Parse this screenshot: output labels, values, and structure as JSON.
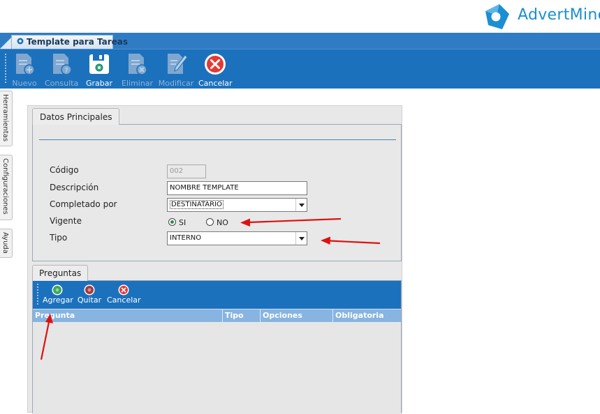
{
  "brand": {
    "name": "AdvertMind",
    "visible_text": "AdvertMinc",
    "color": "#1a8fd1"
  },
  "window_tab": {
    "title": "Template para Tareas"
  },
  "toolbar": {
    "buttons": [
      {
        "label": "Nuevo",
        "icon": "document-add-icon",
        "enabled": false
      },
      {
        "label": "Consulta",
        "icon": "document-query-icon",
        "enabled": false
      },
      {
        "label": "Grabar",
        "icon": "save-disk-icon",
        "enabled": true
      },
      {
        "label": "Eliminar",
        "icon": "document-delete-icon",
        "enabled": false
      },
      {
        "label": "Modificar",
        "icon": "document-edit-icon",
        "enabled": false
      },
      {
        "label": "Cancelar",
        "icon": "cancel-circle-icon",
        "enabled": true
      }
    ]
  },
  "side_tabs": [
    "Herramientas",
    "Configuraciones",
    "Ayuda"
  ],
  "datos_principales": {
    "tab_label": "Datos Principales",
    "fields": {
      "codigo": {
        "label": "Código",
        "value": "002"
      },
      "descripcion": {
        "label": "Descripción",
        "value": "NOMBRE TEMPLATE"
      },
      "completado_por": {
        "label": "Completado por",
        "value": "DESTINATARIO"
      },
      "vigente": {
        "label": "Vigente",
        "options": [
          "SI",
          "NO"
        ],
        "selected": "SI"
      },
      "tipo": {
        "label": "Tipo",
        "value": "INTERNO"
      }
    }
  },
  "preguntas": {
    "tab_label": "Preguntas",
    "toolbar": [
      {
        "label": "Agregar",
        "icon": "add-circle-icon",
        "color": "#3aa657"
      },
      {
        "label": "Quitar",
        "icon": "remove-circle-icon",
        "color": "#a23a3a"
      },
      {
        "label": "Cancelar",
        "icon": "cancel-circle-icon",
        "color": "#e53935"
      }
    ],
    "columns": [
      "Pregunta",
      "Tipo",
      "Opciones",
      "Obligatoria"
    ],
    "rows": []
  },
  "colors": {
    "toolbar_blue": "#1c71bd",
    "grid_header": "#87b4e0",
    "annotation_arrow": "#e01010"
  }
}
